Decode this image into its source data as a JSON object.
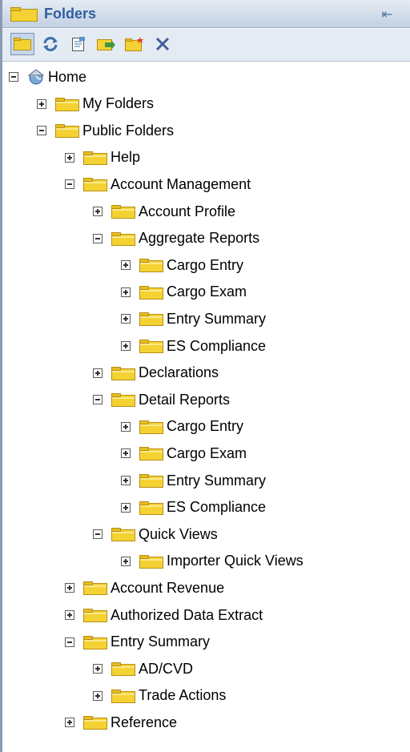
{
  "panel": {
    "title": "Folders"
  },
  "toolbar": {
    "buttons": [
      {
        "icon": "folder-view-icon",
        "active": true
      },
      {
        "icon": "refresh-icon"
      },
      {
        "icon": "properties-icon"
      },
      {
        "icon": "move-icon"
      },
      {
        "icon": "new-folder-icon"
      },
      {
        "icon": "delete-icon"
      }
    ]
  },
  "colors": {
    "header_title": "#2f5da0",
    "folder_fill": "#f5d233",
    "panel_border": "#8a9bb4"
  },
  "tree": [
    {
      "label": "Home",
      "depth": 0,
      "state": "expanded",
      "icon": "home-globe-icon"
    },
    {
      "label": "My Folders",
      "depth": 1,
      "state": "collapsed",
      "icon": "folder-icon"
    },
    {
      "label": "Public Folders",
      "depth": 1,
      "state": "expanded",
      "icon": "folder-icon"
    },
    {
      "label": "Help",
      "depth": 2,
      "state": "collapsed",
      "icon": "folder-icon"
    },
    {
      "label": "Account Management",
      "depth": 2,
      "state": "expanded",
      "icon": "folder-icon"
    },
    {
      "label": "Account Profile",
      "depth": 3,
      "state": "collapsed",
      "icon": "folder-icon"
    },
    {
      "label": "Aggregate Reports",
      "depth": 3,
      "state": "expanded",
      "icon": "folder-icon"
    },
    {
      "label": "Cargo Entry",
      "depth": 4,
      "state": "collapsed",
      "icon": "folder-icon"
    },
    {
      "label": "Cargo Exam",
      "depth": 4,
      "state": "collapsed",
      "icon": "folder-icon"
    },
    {
      "label": "Entry Summary",
      "depth": 4,
      "state": "collapsed",
      "icon": "folder-icon"
    },
    {
      "label": "ES Compliance",
      "depth": 4,
      "state": "collapsed",
      "icon": "folder-icon"
    },
    {
      "label": "Declarations",
      "depth": 3,
      "state": "collapsed",
      "icon": "folder-icon"
    },
    {
      "label": "Detail Reports",
      "depth": 3,
      "state": "expanded",
      "icon": "folder-icon"
    },
    {
      "label": "Cargo Entry",
      "depth": 4,
      "state": "collapsed",
      "icon": "folder-icon"
    },
    {
      "label": "Cargo Exam",
      "depth": 4,
      "state": "collapsed",
      "icon": "folder-icon"
    },
    {
      "label": "Entry Summary",
      "depth": 4,
      "state": "collapsed",
      "icon": "folder-icon"
    },
    {
      "label": "ES Compliance",
      "depth": 4,
      "state": "collapsed",
      "icon": "folder-icon"
    },
    {
      "label": "Quick Views",
      "depth": 3,
      "state": "expanded",
      "icon": "folder-icon"
    },
    {
      "label": "Importer Quick Views",
      "depth": 4,
      "state": "collapsed",
      "icon": "folder-icon"
    },
    {
      "label": "Account Revenue",
      "depth": 2,
      "state": "collapsed",
      "icon": "folder-icon"
    },
    {
      "label": "Authorized Data Extract",
      "depth": 2,
      "state": "collapsed",
      "icon": "folder-icon"
    },
    {
      "label": "Entry Summary",
      "depth": 2,
      "state": "expanded",
      "icon": "folder-icon"
    },
    {
      "label": "AD/CVD",
      "depth": 3,
      "state": "collapsed",
      "icon": "folder-icon"
    },
    {
      "label": "Trade Actions",
      "depth": 3,
      "state": "collapsed",
      "icon": "folder-icon"
    },
    {
      "label": "Reference",
      "depth": 2,
      "state": "collapsed",
      "icon": "folder-icon"
    }
  ]
}
